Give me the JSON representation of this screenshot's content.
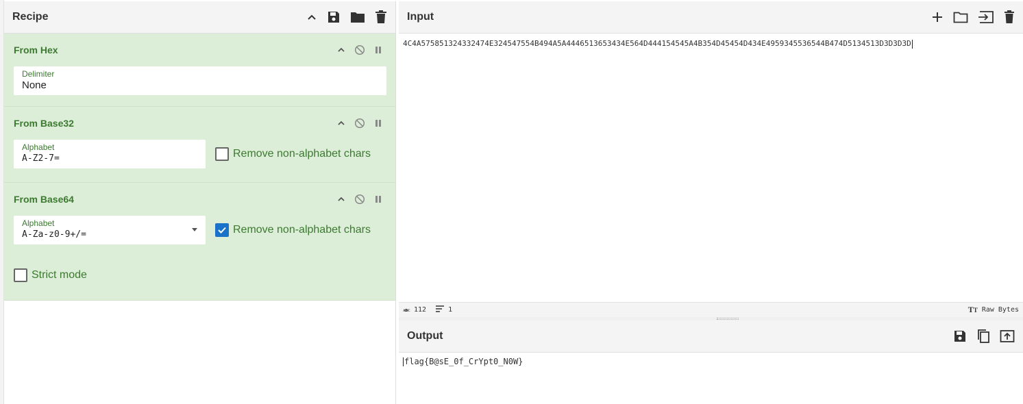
{
  "recipe": {
    "title": "Recipe",
    "operations": [
      {
        "name": "From Hex",
        "delimiter_label": "Delimiter",
        "delimiter_value": "None"
      },
      {
        "name": "From Base32",
        "alphabet_label": "Alphabet",
        "alphabet_value": "A-Z2-7=",
        "remove_label": "Remove non-alphabet chars",
        "remove_checked": false
      },
      {
        "name": "From Base64",
        "alphabet_label": "Alphabet",
        "alphabet_value": "A-Za-z0-9+/=",
        "remove_label": "Remove non-alphabet chars",
        "remove_checked": true,
        "strict_label": "Strict mode",
        "strict_checked": false
      }
    ]
  },
  "input": {
    "title": "Input",
    "text": "4C4A575851324332474E324547554B494A5A4446513653434E564D444154545A4B354D45454D434E4959345536544B474D5134513D3D3D3D",
    "length": "112",
    "lines": "1",
    "encoding": "Raw Bytes"
  },
  "output": {
    "title": "Output",
    "text": "flag{B@sE_0f_CrYpt0_N0W}"
  },
  "colors": {
    "operation_bg": "#dcedd8",
    "operation_text": "#3b7a2f",
    "checkbox_checked": "#1a73c9"
  }
}
